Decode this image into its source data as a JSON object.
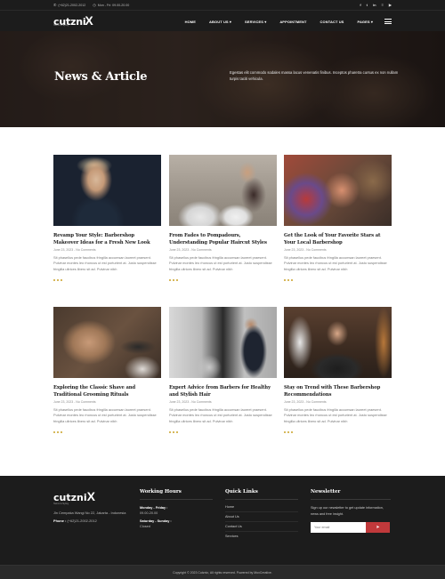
{
  "topbar": {
    "phone": "(+62)21-2002-2012",
    "hours": "Mon - Fri: 09.00-20.00",
    "social": [
      {
        "icon": "facebook-icon",
        "glyph": "f"
      },
      {
        "icon": "twitter-icon",
        "glyph": "t"
      },
      {
        "icon": "linkedin-icon",
        "glyph": "in"
      },
      {
        "icon": "rss-icon",
        "glyph": "≡"
      },
      {
        "icon": "youtube-icon",
        "glyph": "▶"
      }
    ]
  },
  "logo": {
    "word": "cutzni",
    "mark": "X",
    "tagline": "Haircut & Styling"
  },
  "nav": {
    "items": [
      {
        "label": "HOME"
      },
      {
        "label": "ABOUT US ▾"
      },
      {
        "label": "SERVICES ▾"
      },
      {
        "label": "APPOINTMENT"
      },
      {
        "label": "CONTACT US"
      },
      {
        "label": "PAGES ▾"
      }
    ]
  },
  "hero": {
    "title": "News & Article",
    "text": "Egestas elit commodo sodales massa lacus venenatis finibus. Inceptos pharetra cursus ex non nullam turpis taciti vehicula."
  },
  "posts": [
    {
      "title": "Revamp Your Style: Barbershop Makeover Ideas for a Fresh New Look",
      "meta": "June 23, 2023 - No Comments",
      "excerpt": "Sit phasellus pede faucibus fringilla accumsan laoreet praesent. Pulvinar montes leo rhoncus ut est porturient at. Justo suspendisse fringilla ultrices libero sit ad. Pulvinar nibh",
      "image": "man-portrait"
    },
    {
      "title": "From Fades to Pompadours, Understanding Popular Haircut Styles",
      "meta": "June 23, 2023 - No Comments",
      "excerpt": "Sit phasellus pede faucibus fringilla accumsan laoreet praesent. Pulvinar montes leo rhoncus ut est porturient at. Justo suspendisse fringilla ultrices libero sit ad. Pulvinar nibh",
      "image": "barbers-cutting"
    },
    {
      "title": "Get the Look of Your Favorite Stars at Your Local Barbershop",
      "meta": "June 23, 2023 - No Comments",
      "excerpt": "Sit phasellus pede faucibus fringilla accumsan laoreet praesent. Pulvinar montes leo rhoncus ut est porturient at. Justo suspendisse fringilla ultrices libero sit ad. Pulvinar nibh",
      "image": "barber-closeup"
    },
    {
      "title": "Exploring the Classic Shave and Traditional Grooming Rituals",
      "meta": "June 23, 2023 - No Comments",
      "excerpt": "Sit phasellus pede faucibus fringilla accumsan laoreet praesent. Pulvinar montes leo rhoncus ut est porturient at. Justo suspendisse fringilla ultrices libero sit ad. Pulvinar nibh",
      "image": "beard-trim"
    },
    {
      "title": "Expert Advice from Barbers for Healthy and Stylish Hair",
      "meta": "June 23, 2023 - No Comments",
      "excerpt": "Sit phasellus pede faucibus fringilla accumsan laoreet praesent. Pulvinar montes leo rhoncus ut est porturient at. Justo suspendisse fringilla ultrices libero sit ad. Pulvinar nibh",
      "image": "barber-styling"
    },
    {
      "title": "Stay on Trend with These Barbershop Recommendations",
      "meta": "June 23, 2023 - No Comments",
      "excerpt": "Sit phasellus pede faucibus fringilla accumsan laoreet praesent. Pulvinar montes leo rhoncus ut est porturient at. Justo suspendisse fringilla ultrices libero sit ad. Pulvinar nibh",
      "image": "barbershop-chair"
    }
  ],
  "footer": {
    "address": "Jln Cempaka Wangi No 22, Jakarta - Indonesia",
    "phone_label": "Phone :",
    "phone": "(+62)21-2002-2012",
    "working_hours": {
      "title": "Working Hours",
      "rows": [
        {
          "label": "Monday - Friday :",
          "value": "09.00-20.00"
        },
        {
          "label": "Saturday - Sunday :",
          "value": "Closed"
        }
      ]
    },
    "quick_links": {
      "title": "Quick Links",
      "items": [
        "Home",
        "About Us",
        "Contact Us",
        "Services"
      ]
    },
    "newsletter": {
      "title": "Newsletter",
      "text": "Sign up our newsletter to get update information, news and free insight.",
      "placeholder": "Your email",
      "button_icon": "send-icon"
    },
    "copyright": "Copyright © 2023 Cutznix, All rights reserved. Powered by MoxCreative."
  },
  "colors": {
    "dark_bg": "#1c1c1c",
    "accent_red": "#c0393b",
    "accent_gold": "#c9a227"
  }
}
